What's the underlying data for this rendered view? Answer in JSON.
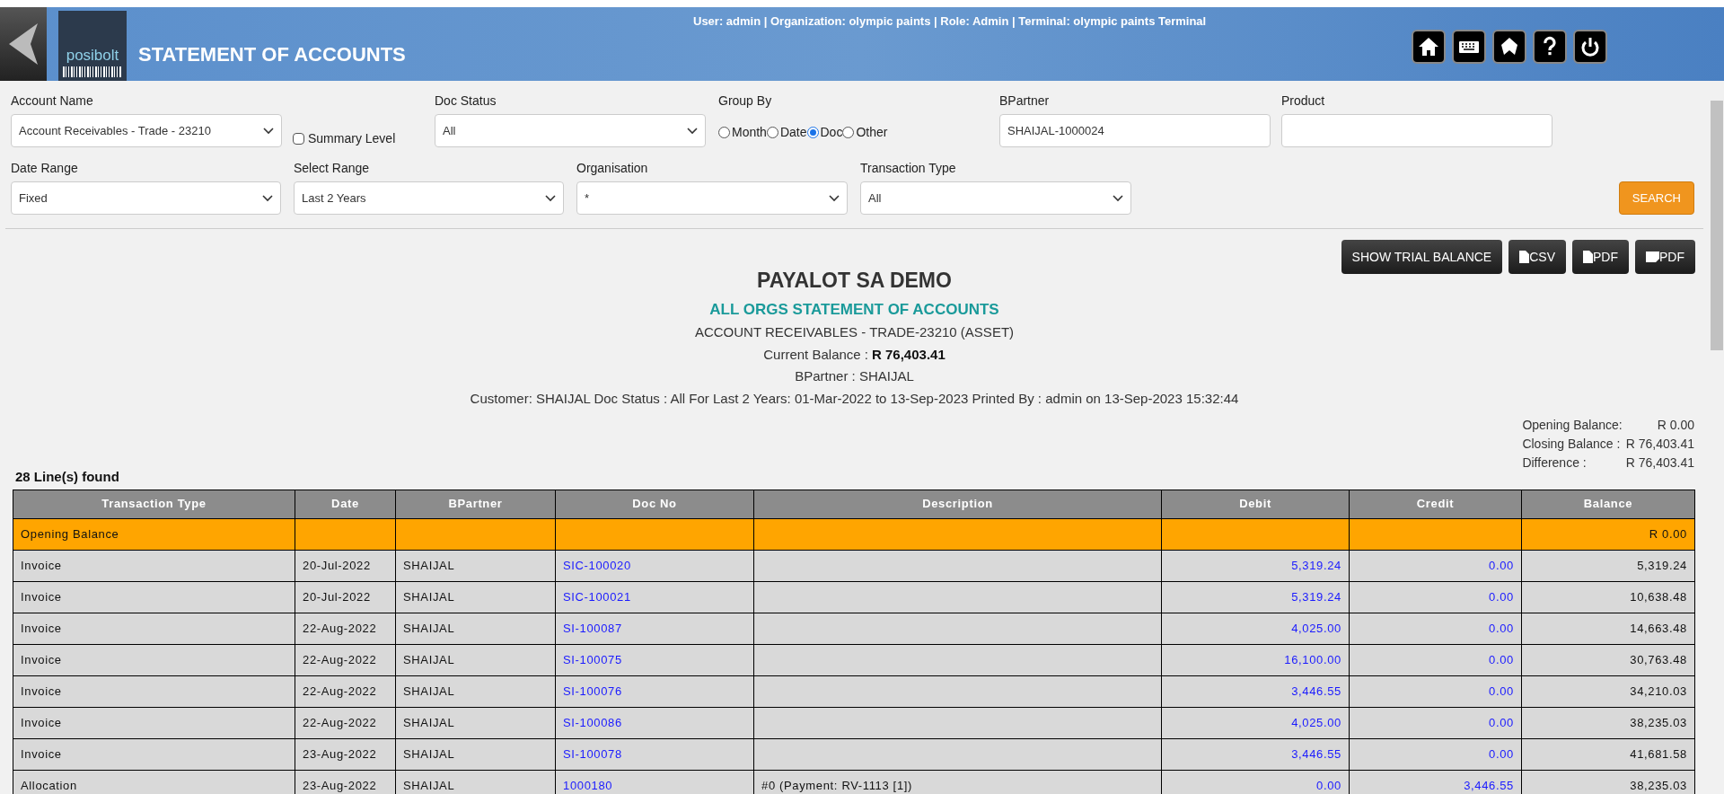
{
  "header": {
    "title": "STATEMENT OF ACCOUNTS",
    "logo_text": "posibolt",
    "user_info": "User: admin | Organization: olympic paints | Role: Admin | Terminal: olympic paints Terminal"
  },
  "filters": {
    "account_name": {
      "label": "Account Name",
      "value": "Account Receivables - Trade - 23210"
    },
    "summary_level": {
      "label": "Summary Level",
      "checked": false
    },
    "doc_status": {
      "label": "Doc Status",
      "value": "All"
    },
    "group_by": {
      "label": "Group By",
      "options": [
        {
          "label": "Month",
          "selected": false
        },
        {
          "label": "Date",
          "selected": false
        },
        {
          "label": "Doc",
          "selected": true
        },
        {
          "label": "Other",
          "selected": false
        }
      ]
    },
    "bpartner": {
      "label": "BPartner",
      "value": "SHAIJAL-1000024"
    },
    "product": {
      "label": "Product"
    },
    "date_range": {
      "label": "Date Range",
      "value": "Fixed"
    },
    "select_range": {
      "label": "Select Range",
      "value": "Last 2 Years"
    },
    "organisation": {
      "label": "Organisation",
      "value": "*"
    },
    "transaction_type": {
      "label": "Transaction Type",
      "value": "All"
    },
    "search_button": "SEARCH"
  },
  "actions": [
    {
      "label": "SHOW TRIAL BALANCE",
      "kind": "plain"
    },
    {
      "label": "CSV",
      "kind": "file"
    },
    {
      "label": "PDF",
      "kind": "file"
    },
    {
      "label": "PDF",
      "kind": "file-alt"
    }
  ],
  "report": {
    "company": "PAYALOT SA DEMO",
    "title": "ALL ORGS STATEMENT OF ACCOUNTS",
    "account": "ACCOUNT RECEIVABLES - TRADE-23210 (ASSET)",
    "current_balance_label": "Current Balance :",
    "current_balance": "R 76,403.41",
    "bpartner": "BPartner : SHAIJAL",
    "criteria": "Customer: SHAIJAL Doc Status : All For Last 2 Years: 01-Mar-2022 to 13-Sep-2023 Printed By : admin on 13-Sep-2023 15:32:44",
    "summary": [
      {
        "label": "Opening Balance:",
        "value": "R 0.00"
      },
      {
        "label": "Closing Balance :",
        "value": "R 76,403.41"
      },
      {
        "label": "Difference :",
        "value": "R 76,403.41"
      }
    ],
    "lines_found": "28 Line(s) found"
  },
  "table": {
    "columns": [
      "Transaction Type",
      "Date",
      "BPartner",
      "Doc No",
      "Description",
      "Debit",
      "Credit",
      "Balance"
    ],
    "rows": [
      {
        "kind": "opening",
        "cells": [
          "Opening Balance",
          "",
          "",
          "",
          "",
          "",
          "",
          "R 0.00"
        ]
      },
      {
        "kind": "line",
        "cells": [
          "Invoice",
          "20-Jul-2022",
          "SHAIJAL",
          "SIC-100020",
          "",
          "5,319.24",
          "0.00",
          "5,319.24"
        ]
      },
      {
        "kind": "line",
        "cells": [
          "Invoice",
          "20-Jul-2022",
          "SHAIJAL",
          "SIC-100021",
          "",
          "5,319.24",
          "0.00",
          "10,638.48"
        ]
      },
      {
        "kind": "line",
        "cells": [
          "Invoice",
          "22-Aug-2022",
          "SHAIJAL",
          "SI-100087",
          "",
          "4,025.00",
          "0.00",
          "14,663.48"
        ]
      },
      {
        "kind": "line",
        "cells": [
          "Invoice",
          "22-Aug-2022",
          "SHAIJAL",
          "SI-100075",
          "",
          "16,100.00",
          "0.00",
          "30,763.48"
        ]
      },
      {
        "kind": "line",
        "cells": [
          "Invoice",
          "22-Aug-2022",
          "SHAIJAL",
          "SI-100076",
          "",
          "3,446.55",
          "0.00",
          "34,210.03"
        ]
      },
      {
        "kind": "line",
        "cells": [
          "Invoice",
          "22-Aug-2022",
          "SHAIJAL",
          "SI-100086",
          "",
          "4,025.00",
          "0.00",
          "38,235.03"
        ]
      },
      {
        "kind": "line",
        "cells": [
          "Invoice",
          "23-Aug-2022",
          "SHAIJAL",
          "SI-100078",
          "",
          "3,446.55",
          "0.00",
          "41,681.58"
        ]
      },
      {
        "kind": "line",
        "cells": [
          "Allocation",
          "23-Aug-2022",
          "SHAIJAL",
          "1000180",
          "#0 (Payment: RV-1113 [1])",
          "0.00",
          "3,446.55",
          "38,235.03"
        ]
      }
    ]
  }
}
